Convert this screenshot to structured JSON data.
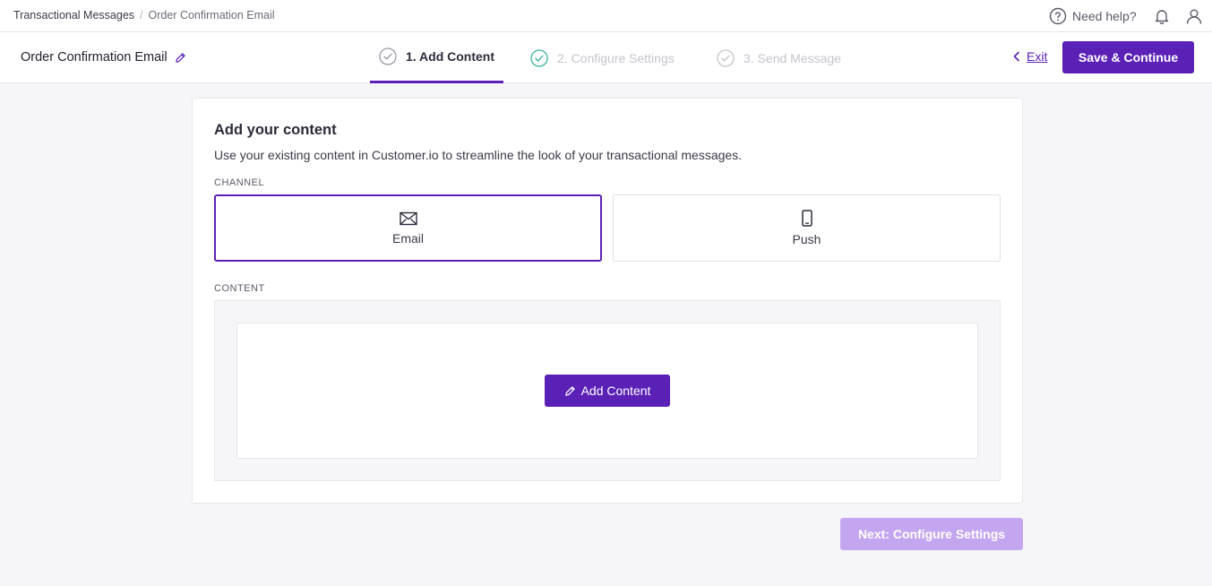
{
  "breadcrumb": {
    "parent": "Transactional Messages",
    "separator": "/",
    "current": "Order Confirmation Email"
  },
  "header": {
    "help_label": "Need help?"
  },
  "stepbar": {
    "title": "Order Confirmation Email",
    "steps": [
      {
        "label": "1. Add Content",
        "state": "active"
      },
      {
        "label": "2. Configure Settings",
        "state": "inactive"
      },
      {
        "label": "3. Send Message",
        "state": "inactive"
      }
    ],
    "exit_label": "Exit",
    "save_label": "Save & Continue"
  },
  "card": {
    "heading": "Add your content",
    "description": "Use your existing content in Customer.io to streamline the look of your transactional messages.",
    "channel_label": "CHANNEL",
    "channels": [
      {
        "label": "Email",
        "icon": "envelope-icon",
        "selected": true
      },
      {
        "label": "Push",
        "icon": "mobile-phone-icon",
        "selected": false
      }
    ],
    "content_label": "CONTENT",
    "add_content_label": "Add Content"
  },
  "footer": {
    "next_label": "Next: Configure Settings"
  },
  "colors": {
    "accent": "#5b21b6",
    "step_check": "#3bb39b",
    "disabled_button": "#c4a6f0"
  }
}
